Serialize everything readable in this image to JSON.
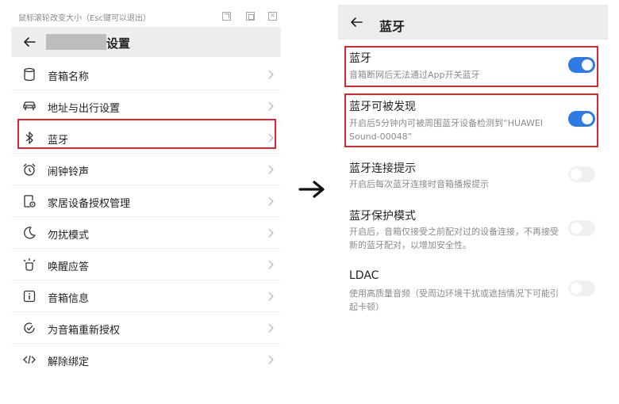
{
  "left_panel": {
    "window_hint": "鼠标滚轮改变大小（Esc键可以退出）",
    "window_controls": [
      "open-external-icon",
      "fullscreen-icon",
      "close-icon"
    ],
    "title": "设置",
    "menu_items": [
      {
        "label": "音箱名称",
        "icon": "speaker-icon"
      },
      {
        "label": "地址与出行设置",
        "icon": "car-icon"
      },
      {
        "label": "蓝牙",
        "icon": "bluetooth-icon",
        "highlighted": true
      },
      {
        "label": "闹钟铃声",
        "icon": "alarm-clock-icon"
      },
      {
        "label": "家居设备授权管理",
        "icon": "device-auth-icon"
      },
      {
        "label": "勿扰模式",
        "icon": "moon-icon"
      },
      {
        "label": "唤醒应答",
        "icon": "wake-response-icon"
      },
      {
        "label": "音箱信息",
        "icon": "info-icon"
      },
      {
        "label": "为音箱重新授权",
        "icon": "reauthorize-icon"
      },
      {
        "label": "解除绑定",
        "icon": "unbind-icon"
      }
    ]
  },
  "right_panel": {
    "title": "蓝牙",
    "settings": [
      {
        "title": "蓝牙",
        "desc": "音箱断网后无法通过App开关蓝牙",
        "enabled": true,
        "highlighted": true
      },
      {
        "title": "蓝牙可被发现",
        "desc": "开启后5分钟内可被周围蓝牙设备检测到“HUAWEI Sound-00048”",
        "enabled": true,
        "highlighted": true
      },
      {
        "title": "蓝牙连接提示",
        "desc": "开启后每次蓝牙连接时音箱播报提示",
        "enabled": false
      },
      {
        "title": "蓝牙保护模式",
        "desc": "开启后，音箱仅接受之前配对过的设备连接，不再接受新的蓝牙配对，以增加安全性。",
        "enabled": false
      },
      {
        "title": "LDAC",
        "desc": "使用高质量音频（受周边环境干扰或遮挡情况下可能引起卡顿）",
        "enabled": false
      }
    ]
  },
  "colors": {
    "highlight_border": "#d9272e",
    "toggle_on": "#2f7be6",
    "toggle_off": "#f0f0f0",
    "header_bg": "#eeeeee"
  }
}
